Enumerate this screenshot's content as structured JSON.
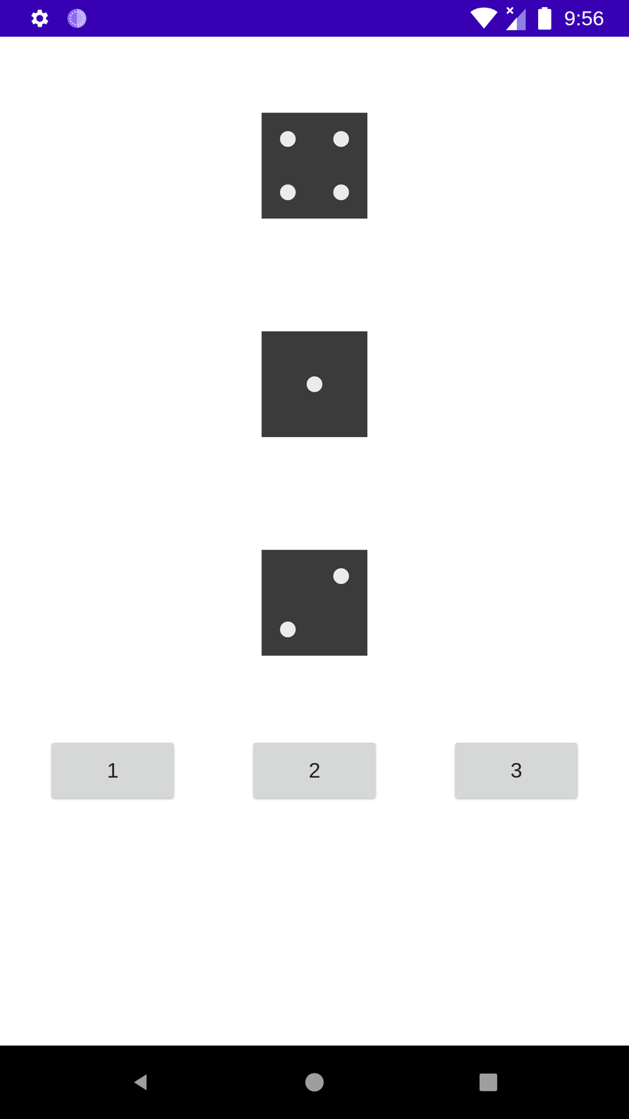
{
  "status_bar": {
    "time": "9:56"
  },
  "dice": [
    {
      "pips": 4
    },
    {
      "pips": 1
    },
    {
      "pips": 2
    }
  ],
  "buttons": [
    "1",
    "2",
    "3"
  ]
}
